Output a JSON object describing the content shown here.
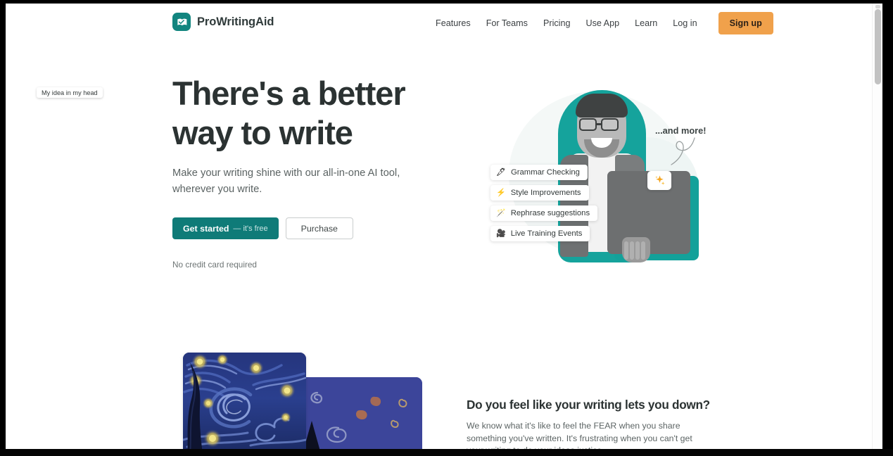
{
  "header": {
    "brand_name": "ProWritingAid",
    "logo_icon": "prowritingaid-book-logo",
    "nav": [
      {
        "label": "Features",
        "name": "features"
      },
      {
        "label": "For Teams",
        "name": "for-teams"
      },
      {
        "label": "Pricing",
        "name": "pricing"
      },
      {
        "label": "Use App",
        "name": "use-app"
      },
      {
        "label": "Learn",
        "name": "learn"
      },
      {
        "label": "Log in",
        "name": "log-in"
      }
    ],
    "signup_label": "Sign up",
    "signup_color": "#f0a14b"
  },
  "hero": {
    "title_line1": "There's a better",
    "title_line2": "way to write",
    "subtitle": "Make your writing shine with our all-in-one AI tool, wherever you write.",
    "primary_cta": "Get started",
    "primary_cta_sub": "— it's free",
    "primary_cta_color": "#0f7b78",
    "secondary_cta": "Purchase",
    "note": "No credit card required",
    "annotation": "...and more!",
    "sparkle_icon": "sparkles-icon",
    "badges": [
      {
        "label": "Grammar Checking",
        "icon": "quill-pen-icon",
        "glyph": "🖋"
      },
      {
        "label": "Style Improvements",
        "icon": "lightning-bolt-icon",
        "glyph": "⚡"
      },
      {
        "label": "Rephrase suggestions",
        "icon": "magic-wand-icon",
        "glyph": "🪄"
      },
      {
        "label": "Live Training Events",
        "icon": "film-camera-icon",
        "glyph": "🎥"
      }
    ]
  },
  "lower": {
    "idea_caption": "My idea in my head",
    "title": "Do you feel like your writing lets you down?",
    "body": "We know what it's like to feel the FEAR when you share something you've written. It's frustrating when you can't get your writing to do your ideas justice."
  },
  "scrollbar": {
    "thumb_position": "top"
  }
}
